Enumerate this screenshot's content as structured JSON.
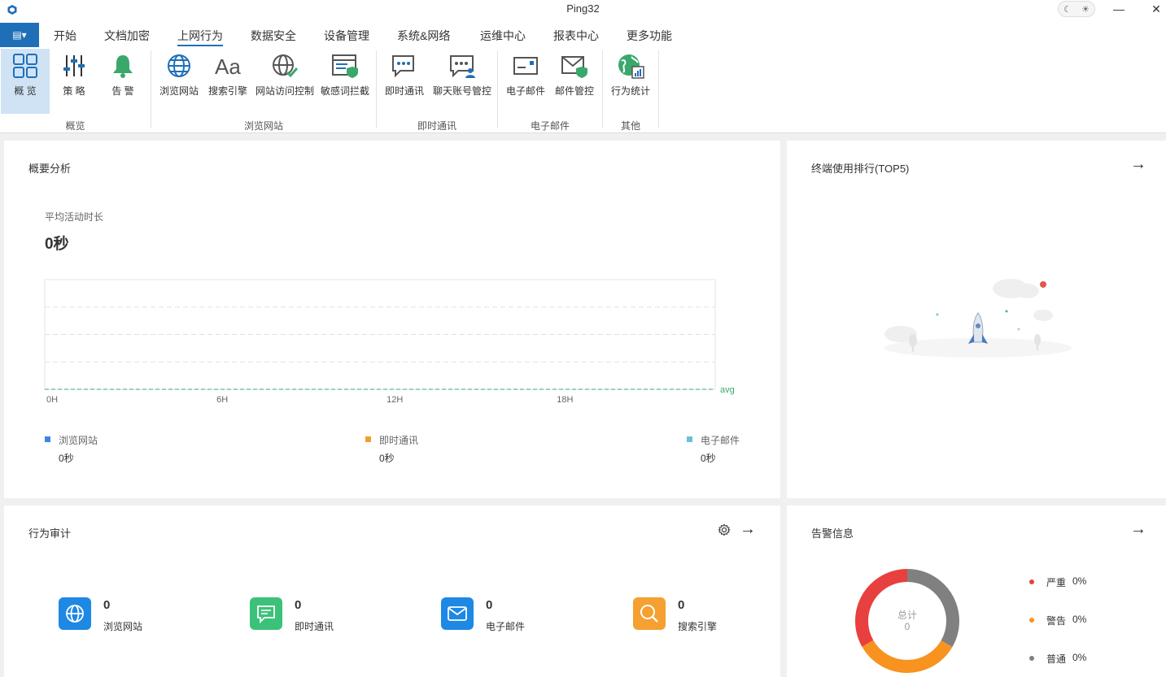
{
  "window": {
    "title": "Ping32",
    "minimize": "—",
    "close": "✕"
  },
  "menubar": {
    "home": "▤▾",
    "items": [
      "开始",
      "文档加密",
      "上网行为",
      "数据安全",
      "设备管理",
      "系统&网络",
      "运维中心",
      "报表中心",
      "更多功能"
    ],
    "active_index": 2
  },
  "ribbon": {
    "buttons": [
      {
        "label": "概 览",
        "icon": "grid-icon"
      },
      {
        "label": "策 略",
        "icon": "sliders-icon"
      },
      {
        "label": "告 警",
        "icon": "bell-icon"
      },
      {
        "label": "浏览网站",
        "icon": "globe-icon"
      },
      {
        "label": "搜索引擎",
        "icon": "font-aa-icon"
      },
      {
        "label": "网站访问控制",
        "icon": "globe-check-icon"
      },
      {
        "label": "敏感词拦截",
        "icon": "window-shield-icon"
      },
      {
        "label": "即时通讯",
        "icon": "chat-icon"
      },
      {
        "label": "聊天账号管控",
        "icon": "chat-user-icon"
      },
      {
        "label": "电子邮件",
        "icon": "envelope-icon"
      },
      {
        "label": "邮件管控",
        "icon": "envelope-shield-icon"
      },
      {
        "label": "行为统计",
        "icon": "globe-stats-icon"
      }
    ],
    "groups": [
      "概览",
      "浏览网站",
      "即时通讯",
      "电子邮件",
      "其他"
    ]
  },
  "overview": {
    "title": "概要分析",
    "avg_label": "平均活动时长",
    "avg_value": "0秒",
    "chart_data": {
      "type": "line",
      "x_ticks": [
        "0H",
        "6H",
        "12H",
        "18H"
      ],
      "values": [
        0
      ],
      "avg_label": "avg",
      "grid": true
    },
    "legend": [
      {
        "name": "浏览网站",
        "value": "0秒",
        "color": "#3a86e8"
      },
      {
        "name": "即时通讯",
        "value": "0秒",
        "color": "#f0a030"
      },
      {
        "name": "电子邮件",
        "value": "0秒",
        "color": "#6cc0d8"
      }
    ]
  },
  "terminal_rank": {
    "title": "终端使用排行(TOP5)"
  },
  "audit": {
    "title": "行为审计",
    "stats": [
      {
        "num": "0",
        "name": "浏览网站",
        "color": "#1e88e5",
        "icon": "globe-icon"
      },
      {
        "num": "0",
        "name": "即时通讯",
        "color": "#3cc17a",
        "icon": "chat-icon"
      },
      {
        "num": "0",
        "name": "电子邮件",
        "color": "#1e88e5",
        "icon": "envelope-icon"
      },
      {
        "num": "0",
        "name": "搜索引擎",
        "color": "#f5a030",
        "icon": "search-icon"
      }
    ]
  },
  "alarm": {
    "title": "告警信息",
    "center_label": "总计",
    "center_value": "0",
    "items": [
      {
        "name": "严重",
        "pct": "0%",
        "color": "#e8403e"
      },
      {
        "name": "警告",
        "pct": "0%",
        "color": "#f7931e"
      },
      {
        "name": "普通",
        "pct": "0%",
        "color": "#808080"
      }
    ]
  }
}
